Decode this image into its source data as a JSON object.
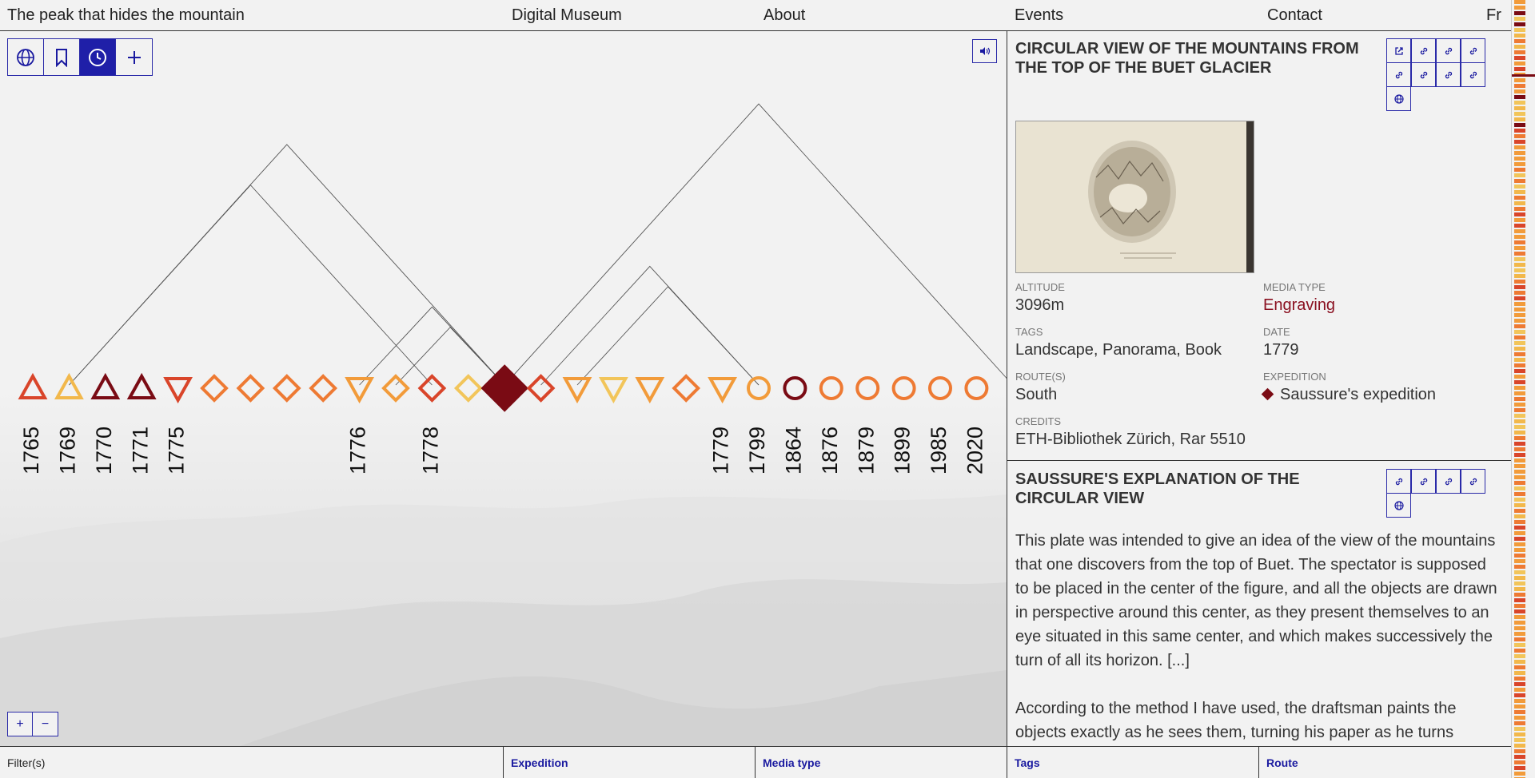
{
  "nav": {
    "site_title": "The peak that hides the mountain",
    "items": [
      "Digital Museum",
      "About",
      "Events",
      "Contact"
    ],
    "language": "Fr"
  },
  "toolbar": {
    "views": [
      {
        "icon": "globe-icon",
        "active": false
      },
      {
        "icon": "bookmark-icon",
        "active": false
      },
      {
        "icon": "clock-icon",
        "active": true
      },
      {
        "icon": "plus-icon",
        "active": false
      }
    ],
    "sound_icon": "speaker-icon"
  },
  "zoom": {
    "in_label": "+",
    "out_label": "−"
  },
  "timeline": {
    "items": [
      {
        "shape": "triangle-up",
        "color": "#d9452a",
        "year": "1765",
        "selected": false
      },
      {
        "shape": "triangle-up",
        "color": "#f2b84b",
        "year": "1769",
        "selected": false
      },
      {
        "shape": "triangle-up",
        "color": "#7a0b14",
        "year": "1770",
        "selected": false
      },
      {
        "shape": "triangle-up",
        "color": "#7a0b14",
        "year": "1771",
        "selected": false
      },
      {
        "shape": "triangle-down",
        "color": "#d9452a",
        "year": "1775",
        "selected": false
      },
      {
        "shape": "diamond",
        "color": "#ee7a33",
        "year": "",
        "selected": false
      },
      {
        "shape": "diamond",
        "color": "#ee7a33",
        "year": "",
        "selected": false
      },
      {
        "shape": "diamond",
        "color": "#ee7a33",
        "year": "",
        "selected": false
      },
      {
        "shape": "diamond",
        "color": "#ee7a33",
        "year": "",
        "selected": false
      },
      {
        "shape": "triangle-down",
        "color": "#f29b3a",
        "year": "1776",
        "selected": false
      },
      {
        "shape": "diamond",
        "color": "#f29b3a",
        "year": "",
        "selected": false
      },
      {
        "shape": "diamond",
        "color": "#d9452a",
        "year": "1778",
        "selected": false
      },
      {
        "shape": "diamond",
        "color": "#f2c55a",
        "year": "",
        "selected": false
      },
      {
        "shape": "diamond",
        "color": "#7a0b14",
        "year": "",
        "selected": true
      },
      {
        "shape": "diamond",
        "color": "#d9452a",
        "year": "",
        "selected": false
      },
      {
        "shape": "triangle-down",
        "color": "#f29b3a",
        "year": "",
        "selected": false
      },
      {
        "shape": "triangle-down",
        "color": "#f2c55a",
        "year": "",
        "selected": false
      },
      {
        "shape": "triangle-down",
        "color": "#f29b3a",
        "year": "",
        "selected": false
      },
      {
        "shape": "diamond",
        "color": "#ee7a33",
        "year": "",
        "selected": false
      },
      {
        "shape": "triangle-down",
        "color": "#f29b3a",
        "year": "1779",
        "selected": false
      },
      {
        "shape": "circle",
        "color": "#f29b3a",
        "year": "1799",
        "selected": false
      },
      {
        "shape": "circle",
        "color": "#7a0b14",
        "year": "1864",
        "selected": false
      },
      {
        "shape": "circle",
        "color": "#ee7a33",
        "year": "1876",
        "selected": false
      },
      {
        "shape": "circle",
        "color": "#ee7a33",
        "year": "1879",
        "selected": false
      },
      {
        "shape": "circle",
        "color": "#ee7a33",
        "year": "1899",
        "selected": false
      },
      {
        "shape": "circle",
        "color": "#ee7a33",
        "year": "1985",
        "selected": false
      },
      {
        "shape": "circle",
        "color": "#ee7a33",
        "year": "2020",
        "selected": false
      },
      {
        "shape": "square-partial",
        "color": "#ee7a33",
        "year": "",
        "selected": false
      }
    ],
    "links": [
      [
        1,
        11
      ],
      [
        1,
        13
      ],
      [
        10,
        13
      ],
      [
        9,
        13
      ],
      [
        14,
        20
      ],
      [
        15,
        20
      ],
      [
        13,
        27
      ]
    ]
  },
  "card1": {
    "title": "Circular view of the mountains from the top of the Buet glacier",
    "icons": [
      "external-link-icon",
      "link-icon",
      "link-icon",
      "link-icon",
      "link-icon",
      "link-icon",
      "link-icon",
      "link-icon",
      "globe-icon"
    ],
    "image_alt": "Engraving thumbnail",
    "altitude_label": "ALTITUDE",
    "altitude": "3096m",
    "media_type_label": "MEDIA TYPE",
    "media_type": "Engraving",
    "tags_label": "TAGS",
    "tags": "Landscape, Panorama, Book",
    "date_label": "DATE",
    "date": "1779",
    "routes_label": "ROUTE(S)",
    "routes": "South",
    "expedition_label": "EXPEDITION",
    "expedition": "Saussure's expedition",
    "credits_label": "CREDITS",
    "credits": "ETH-Bibliothek Zürich, Rar 5510"
  },
  "card2": {
    "title": "Saussure's explanation of the circular view",
    "icons": [
      "link-icon",
      "link-icon",
      "link-icon",
      "link-icon",
      "globe-icon"
    ],
    "paragraph1": "This plate was intended to give an idea of the view of the mountains that one discovers from the top of Buet. The spectator is supposed to be placed in the center of the figure, and all the objects are drawn in perspective around this center, as they present themselves to an eye situated in this same center, and which makes successively the turn of all its horizon. [...]",
    "paragraph2": "According to the method I have used, the draftsman paints the objects exactly as he sees them, turning his paper as he turns"
  },
  "filters": {
    "label": "Filter(s)",
    "items": [
      "Expedition",
      "Media type",
      "Tags",
      "Route"
    ]
  },
  "colors": {
    "accent_blue": "#1f1fa8",
    "dark_red": "#7a0b14",
    "orange": "#ee7a33",
    "yellow": "#f2c55a"
  }
}
